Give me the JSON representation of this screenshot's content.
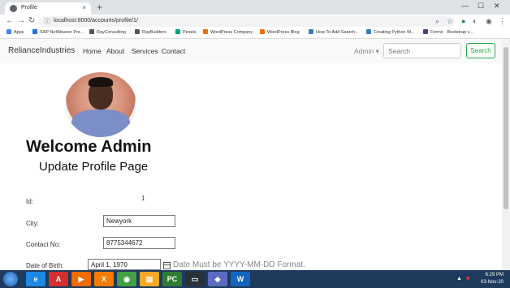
{
  "browser": {
    "tab_title": "Profile",
    "new_tab": "+",
    "tab_close": "×",
    "url": "localhost:8000/accounts/profile/1/",
    "window_controls": [
      "—",
      "☐",
      "✕"
    ],
    "bookmarks": [
      {
        "label": "Apps",
        "color": "#4285f4"
      },
      {
        "label": "SAP NetWeaver Por...",
        "color": "#1a73e8"
      },
      {
        "label": "RayConsulting",
        "color": "#555555"
      },
      {
        "label": "RayBuilders",
        "color": "#555555"
      },
      {
        "label": "Pexels",
        "color": "#05a081"
      },
      {
        "label": "WordPress Company",
        "color": "#e8710a"
      },
      {
        "label": "WordPress Blog",
        "color": "#e8710a"
      },
      {
        "label": "How To Add Search...",
        "color": "#3b7bbf"
      },
      {
        "label": "Creating Python W...",
        "color": "#3b7bbf"
      },
      {
        "label": "Forms · Bootstrap v...",
        "color": "#563d7c"
      }
    ]
  },
  "navbar": {
    "brand": "RelianceIndustries",
    "links": [
      "Home",
      "About",
      "Services",
      "Contact"
    ],
    "user_menu": "Admin ▾",
    "search_placeholder": "Search",
    "search_button": "Search"
  },
  "main": {
    "welcome": "Welcome Admin",
    "subtitle": "Update Profile Page",
    "fields": {
      "id_label": "Id:",
      "id_value": "1",
      "city_label": "City:",
      "city_value": "Newyork",
      "contact_label": "Contact No:",
      "contact_value": "8775344672",
      "dob_label": "Date of Birth:",
      "dob_value": "April 1, 1970",
      "dob_hint": "Date Must be YYYY-MM-DD Format."
    }
  },
  "taskbar": {
    "time": "6:29 PM",
    "date": "03-Nov-20",
    "apps": [
      {
        "name": "ie",
        "glyph": "e",
        "color": "#1e88e5"
      },
      {
        "name": "acrobat",
        "glyph": "A",
        "color": "#d32f2f"
      },
      {
        "name": "media-player",
        "glyph": "▶",
        "color": "#ef6c00"
      },
      {
        "name": "xampp",
        "glyph": "X",
        "color": "#f57c00"
      },
      {
        "name": "chrome",
        "glyph": "◉",
        "color": "#43a047"
      },
      {
        "name": "explorer",
        "glyph": "▤",
        "color": "#f9a825"
      },
      {
        "name": "pycharm",
        "glyph": "PC",
        "color": "#2e7d32"
      },
      {
        "name": "terminal",
        "glyph": "▭",
        "color": "#263238"
      },
      {
        "name": "app",
        "glyph": "◆",
        "color": "#5c6bc0"
      },
      {
        "name": "word",
        "glyph": "W",
        "color": "#1565c0"
      }
    ]
  }
}
